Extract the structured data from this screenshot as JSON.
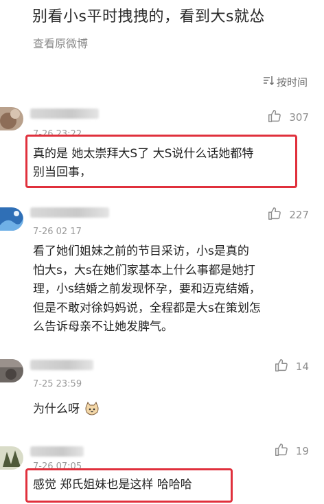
{
  "post": {
    "title": "别看小s平时拽拽的，看到大s就怂",
    "view_original": "查看原微博"
  },
  "sort": {
    "label": "按时间"
  },
  "comments": [
    {
      "time": "7-26 23:22",
      "likes": "307",
      "lines": [
        "真的是  她太崇拜大S了  大S说什么话她都特",
        "别当回事，"
      ],
      "highlighted": true,
      "avatar_color": "#a58a74"
    },
    {
      "time": "7-26 02 17",
      "likes": "227",
      "lines": [
        "看了她们姐妹之前的节目采访，小s是真的",
        "怕大s，大s在她们家基本上什么事都是她打",
        "理，小s结婚之前发现怀孕，要和迈克结婚，",
        "但是不敢对徐妈妈说，全程都是大s在策划怎",
        "么告诉母亲不让她发脾气。"
      ],
      "highlighted": false,
      "avatar_color": "#3a7ec4"
    },
    {
      "time": "7-25 23:59",
      "likes": "14",
      "lines": [
        "为什么呀"
      ],
      "highlighted": false,
      "avatar_color": "#7a7472"
    },
    {
      "time": "7-26 07:05",
      "likes": "19",
      "lines": [
        "感觉  郑氏姐妹也是这样  哈哈哈"
      ],
      "highlighted": true,
      "avatar_color": "#4f5a3a"
    }
  ],
  "colors": {
    "highlight": "#e0303c",
    "muted": "#9a9a9a",
    "text": "#222222"
  },
  "icons": {
    "sort": "sort-icon",
    "like": "thumbs-up-icon",
    "emoji": "cat-face-emoji-icon"
  }
}
